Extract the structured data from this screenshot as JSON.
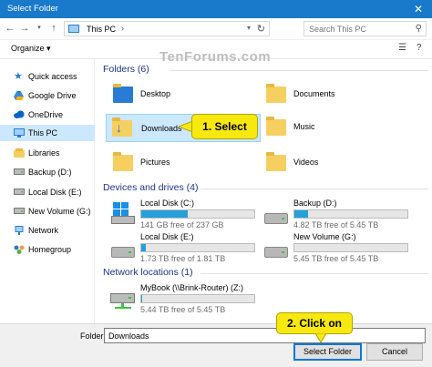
{
  "window": {
    "title": "Select Folder",
    "close_glyph": "✕"
  },
  "address": {
    "path": "This PC"
  },
  "search": {
    "placeholder": "Search This PC"
  },
  "toolbar": {
    "organize_label": "Organize ▾"
  },
  "watermark": "TenForums.com",
  "sidebar": {
    "items": [
      {
        "label": "Quick access",
        "icon": "star-icon"
      },
      {
        "label": "Google Drive",
        "icon": "google-drive-icon"
      },
      {
        "label": "OneDrive",
        "icon": "cloud-icon"
      },
      {
        "label": "This PC",
        "icon": "computer-icon",
        "selected": true
      },
      {
        "label": "Libraries",
        "icon": "library-icon"
      },
      {
        "label": "Backup (D:)",
        "icon": "drive-icon"
      },
      {
        "label": "Local Disk (E:)",
        "icon": "drive-icon"
      },
      {
        "label": "New Volume (G:)",
        "icon": "drive-icon"
      },
      {
        "label": "Network",
        "icon": "network-icon"
      },
      {
        "label": "Homegroup",
        "icon": "homegroup-icon"
      }
    ]
  },
  "folders": {
    "header": "Folders (6)",
    "items": [
      {
        "label": "Desktop"
      },
      {
        "label": "Documents"
      },
      {
        "label": "Downloads"
      },
      {
        "label": "Music"
      },
      {
        "label": "Pictures"
      },
      {
        "label": "Videos"
      }
    ]
  },
  "drives": {
    "header": "Devices and drives (4)",
    "items": [
      {
        "label": "Local Disk (C:)",
        "free": "141 GB free of 237 GB",
        "used_fraction": 0.41
      },
      {
        "label": "Backup (D:)",
        "free": "4.82 TB free of 5.45 TB",
        "used_fraction": 0.12
      },
      {
        "label": "Local Disk (E:)",
        "free": "1.73 TB free of 1.81 TB",
        "used_fraction": 0.04
      },
      {
        "label": "New Volume (G:)",
        "free": "5.45 TB free of 5.45 TB",
        "used_fraction": 0.0
      }
    ]
  },
  "network": {
    "header": "Network locations (1)",
    "items": [
      {
        "label": "MyBook (\\\\Brink-Router) (Z:)",
        "free": "5.44 TB free of 5.45 TB",
        "used_fraction": 0.01
      }
    ]
  },
  "footer": {
    "folder_label": "Folder:",
    "folder_value": "Downloads",
    "select_button": "Select Folder",
    "cancel_button": "Cancel"
  },
  "callouts": {
    "step1": "1. Select",
    "step2": "2. Click on"
  },
  "colors": {
    "titlebar": "#1979ca",
    "selection": "#cce8ff",
    "callout": "#f7e80f",
    "header_text": "#1e3287",
    "capacity_fill": "#26a0da"
  }
}
